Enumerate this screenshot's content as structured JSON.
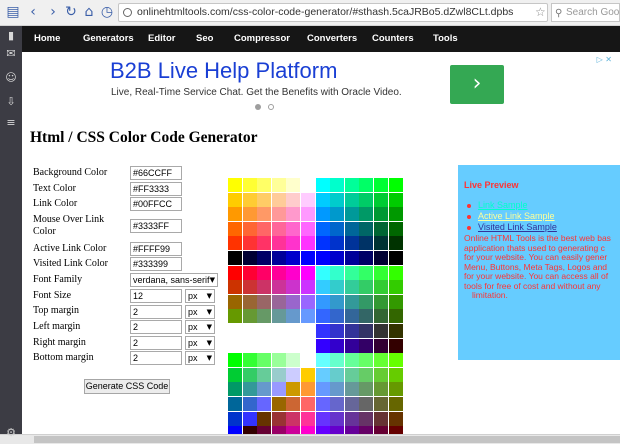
{
  "browser": {
    "url": "onlinehtmltools.com/css-color-code-generator/#sthash.5caJRBo5.dZwl8CLt.dpbs",
    "search_placeholder": "Search Google"
  },
  "nav": [
    "Home",
    "Generators",
    "Editor",
    "Seo",
    "Compressor",
    "Converters",
    "Counters",
    "Tools"
  ],
  "ad": {
    "title": "B2B Live Help Platform",
    "text": "Live, Real-Time Service Chat. Get the Benefits with Oracle Video.",
    "button_glyph": "›"
  },
  "page": {
    "title": "Html / CSS Color Code Generator"
  },
  "form": {
    "fields": [
      {
        "label": "Background Color",
        "value": "#66CCFF"
      },
      {
        "label": "Text Color",
        "value": "#FF3333"
      },
      {
        "label": "Link Color",
        "value": "#00FFCC"
      },
      {
        "label": "Mouse Over Link Color",
        "value": "#3333FF"
      },
      {
        "label": "Active Link Color",
        "value": "#FFFF99"
      },
      {
        "label": "Visited Link Color",
        "value": "#333399"
      }
    ],
    "font_family": {
      "label": "Font Family",
      "value": "verdana, sans-serif"
    },
    "sizes": [
      {
        "label": "Font Size",
        "value": "12",
        "unit": "px"
      },
      {
        "label": "Top margin",
        "value": "2",
        "unit": "px"
      },
      {
        "label": "Left margin",
        "value": "2",
        "unit": "px"
      },
      {
        "label": "Right margin",
        "value": "2",
        "unit": "px"
      },
      {
        "label": "Bottom margin",
        "value": "2",
        "unit": "px"
      }
    ],
    "button": "Generate CSS Code"
  },
  "preview": {
    "title": "Live Preview",
    "links": [
      "Link Sample",
      "Active Link Sample",
      "Visited Link Sample"
    ],
    "body_lines": [
      "Online HTML Tools is the best web bas",
      "application thats used to generating c",
      "for your website. You can easily gener",
      "Menu, Buttons, Meta Tags, Logos and",
      "for your website. You can access all of",
      "tools for free of cost and without any",
      "limitation."
    ]
  },
  "colors": {
    "background": "#66ccff",
    "text": "#ff3333",
    "link": "#00ffcc",
    "hover": "#3333ff",
    "active": "#ffff99",
    "visited": "#333399",
    "ad_title": "#1a3fd4",
    "ad_button": "#34a853",
    "nav_bg": "#161616"
  }
}
